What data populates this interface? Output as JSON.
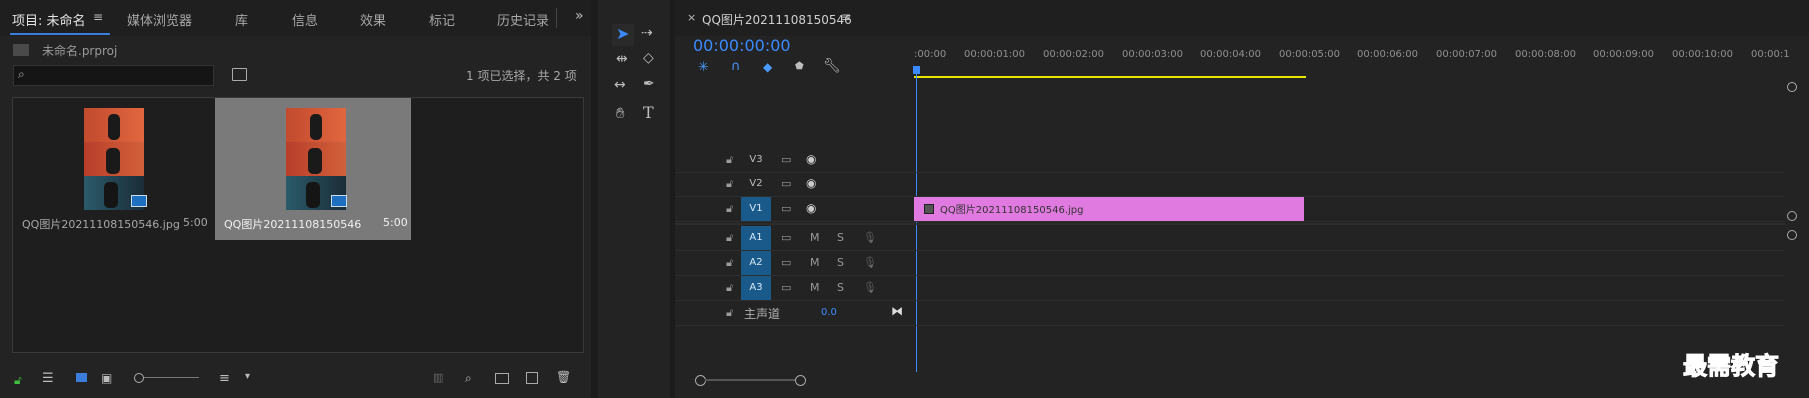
{
  "project_panel": {
    "tabs": [
      {
        "label": "项目: 未命名",
        "active": true
      },
      {
        "label": "媒体浏览器"
      },
      {
        "label": "库"
      },
      {
        "label": "信息"
      },
      {
        "label": "效果"
      },
      {
        "label": "标记"
      },
      {
        "label": "历史记录"
      }
    ],
    "menu_icon": "hamburger-icon",
    "overflow_icon": "double-chevron-right-icon",
    "project_file": "未命名.prproj",
    "search_placeholder": "",
    "selection_status": "1 项已选择，共 2 项",
    "items": [
      {
        "name": "QQ图片20211108150546.jpg",
        "duration": "5:00",
        "selected": false
      },
      {
        "name": "QQ图片20211108150546",
        "duration": "5:00",
        "selected": true
      }
    ]
  },
  "tools": [
    "selection-tool-icon",
    "track-select-tool-icon",
    "ripple-edit-tool-icon",
    "razor-tool-icon",
    "slip-tool-icon",
    "pen-tool-icon",
    "hand-tool-icon",
    "type-tool-icon"
  ],
  "timeline": {
    "sequence_name": "QQ图片20211108150546",
    "timecode": "00:00:00:00",
    "ruler_ticks": [
      ":00:00",
      "00:00:01:00",
      "00:00:02:00",
      "00:00:03:00",
      "00:00:04:00",
      "00:00:05:00",
      "00:00:06:00",
      "00:00:07:00",
      "00:00:08:00",
      "00:00:09:00",
      "00:00:10:00",
      "00:00:1"
    ],
    "video_tracks": [
      "V3",
      "V2",
      "V1"
    ],
    "audio_tracks": [
      "A1",
      "A2",
      "A3"
    ],
    "mute_label": "M",
    "solo_label": "S",
    "master_label": "主声道",
    "master_value": "0.0",
    "clip": {
      "name": "QQ图片20211108150546.jpg",
      "color": "#e07ae0"
    }
  },
  "watermark": "最需教育",
  "colors": {
    "accent": "#3b8bff",
    "yellow": "#e6e600",
    "track_blue": "#1a5a8a"
  }
}
